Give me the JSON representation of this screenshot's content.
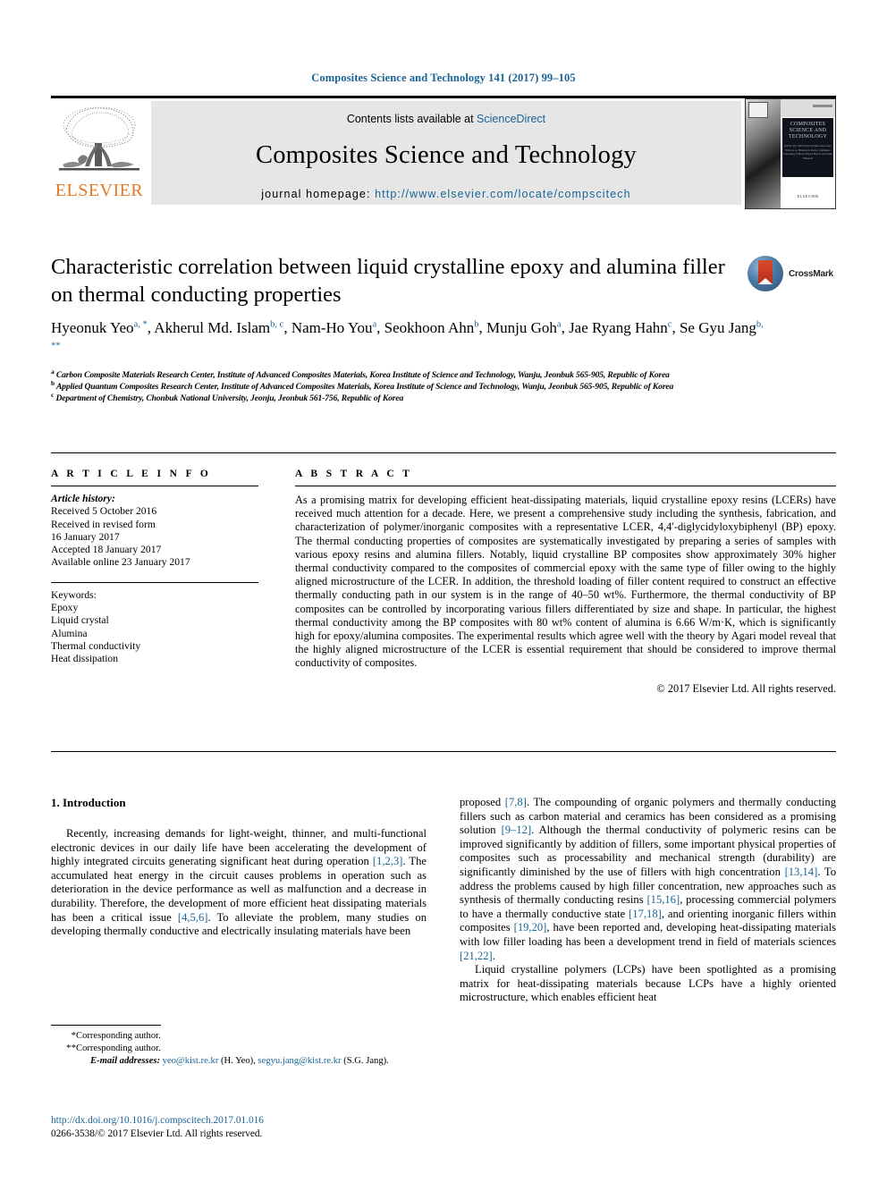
{
  "running_head": "Composites Science and Technology 141 (2017) 99–105",
  "masthead": {
    "publisher_name": "ELSEVIER",
    "contents_prefix": "Contents lists available at ",
    "contents_link": "ScienceDirect",
    "journal_title": "Composites Science and Technology",
    "homepage_label": "journal homepage: ",
    "homepage_url": "http://www.elsevier.com/locate/compscitech",
    "cover": {
      "line1": "COMPOSITES",
      "line2": "SCIENCE AND",
      "line3": "TECHNOLOGY",
      "small": "Editor-in-Chief\nKarl Schulte\n\nAssociate Editors\nA. Bismarck\nPedro Camanho\n\nFounding Editors\nBryan Harris and\nAlan Bunsell",
      "footer": "ELSEVIER"
    }
  },
  "crossmark": {
    "label": "CrossMark",
    "icon": "crossmark-icon"
  },
  "article": {
    "title": "Characteristic correlation between liquid crystalline epoxy and alumina filler on thermal conducting properties",
    "authors_line1_parts": [
      {
        "name": "Hyeonuk Yeo",
        "sup": "a, *"
      },
      {
        "name": "Akherul Md. Islam",
        "sup": "b, c"
      },
      {
        "name": "Nam-Ho You",
        "sup": "a"
      },
      {
        "name": "Seokhoon Ahn",
        "sup": "b"
      },
      {
        "name": "Munju Goh",
        "sup": "a"
      }
    ],
    "authors_line2_parts": [
      {
        "name": "Jae Ryang Hahn",
        "sup": "c"
      },
      {
        "name": "Se Gyu Jang",
        "sup": "b, **"
      }
    ],
    "affiliations": [
      {
        "marker": "a",
        "text": "Carbon Composite Materials Research Center, Institute of Advanced Composites Materials, Korea Institute of Science and Technology, Wanju, Jeonbuk 565-905, Republic of Korea"
      },
      {
        "marker": "b",
        "text": "Applied Quantum Composites Research Center, Institute of Advanced Composites Materials, Korea Institute of Science and Technology, Wanju, Jeonbuk 565-905, Republic of Korea"
      },
      {
        "marker": "c",
        "text": "Department of Chemistry, Chonbuk National University, Jeonju, Jeonbuk 561-756, Republic of Korea"
      }
    ]
  },
  "article_info": {
    "heading": "A R T I C L E   I N F O",
    "history_label": "Article history:",
    "history": [
      "Received 5 October 2016",
      "Received in revised form",
      "16 January 2017",
      "Accepted 18 January 2017",
      "Available online 23 January 2017"
    ],
    "keywords_label": "Keywords:",
    "keywords": [
      "Epoxy",
      "Liquid crystal",
      "Alumina",
      "Thermal conductivity",
      "Heat dissipation"
    ]
  },
  "abstract": {
    "heading": "A B S T R A C T",
    "text": "As a promising matrix for developing efficient heat-dissipating materials, liquid crystalline epoxy resins (LCERs) have received much attention for a decade. Here, we present a comprehensive study including the synthesis, fabrication, and characterization of polymer/inorganic composites with a representative LCER, 4,4′-diglycidyloxybiphenyl (BP) epoxy. The thermal conducting properties of composites are systematically investigated by preparing a series of samples with various epoxy resins and alumina fillers. Notably, liquid crystalline BP composites show approximately 30% higher thermal conductivity compared to the composites of commercial epoxy with the same type of filler owing to the highly aligned microstructure of the LCER. In addition, the threshold loading of filler content required to construct an effective thermally conducting path in our system is in the range of 40–50 wt%. Furthermore, the thermal conductivity of BP composites can be controlled by incorporating various fillers differentiated by size and shape. In particular, the highest thermal conductivity among the BP composites with 80 wt% content of alumina is 6.66 W/m·K, which is significantly high for epoxy/alumina composites. The experimental results which agree well with the theory by Agari model reveal that the highly aligned microstructure of the LCER is essential requirement that should be considered to improve thermal conductivity of composites.",
    "copyright": "© 2017 Elsevier Ltd. All rights reserved."
  },
  "body": {
    "section_number_title": "1. Introduction",
    "left_paragraph_1_a": "Recently, increasing demands for light-weight, thinner, and multi-functional electronic devices in our daily life have been accelerating the development of highly integrated circuits generating significant heat during operation ",
    "left_ref_1": "[1,2,3]",
    "left_paragraph_1_b": ". The accumulated heat energy in the circuit causes problems in operation such as deterioration in the device performance as well as malfunction and a decrease in durability. Therefore, the development of more efficient heat dissipating materials has been a critical issue ",
    "left_ref_2": "[4,5,6]",
    "left_paragraph_1_c": ". To alleviate the problem, many studies on developing thermally conductive and electrically insulating materials have been",
    "right_p1_a": "proposed ",
    "right_ref_1": "[7,8]",
    "right_p1_b": ". The compounding of organic polymers and thermally conducting fillers such as carbon material and ceramics has been considered as a promising solution ",
    "right_ref_2": "[9–12]",
    "right_p1_c": ". Although the thermal conductivity of polymeric resins can be improved significantly by addition of fillers, some important physical properties of composites such as processability and mechanical strength (durability) are significantly diminished by the use of fillers with high concentration ",
    "right_ref_3": "[13,14]",
    "right_p1_d": ". To address the problems caused by high filler concentration, new approaches such as synthesis of thermally conducting resins ",
    "right_ref_4": "[15,16]",
    "right_p1_e": ", processing commercial polymers to have a thermally conductive state ",
    "right_ref_5": "[17,18]",
    "right_p1_f": ", and orienting inorganic fillers within composites ",
    "right_ref_6": "[19,20]",
    "right_p1_g": ", have been reported and, developing heat-dissipating materials with low filler loading has been a development trend in field of materials sciences ",
    "right_ref_7": "[21,22]",
    "right_p1_h": ".",
    "right_p2": "Liquid crystalline polymers (LCPs) have been spotlighted as a promising matrix for heat-dissipating materials because LCPs have a highly oriented microstructure, which enables efficient heat"
  },
  "footnotes": {
    "corresponding_1_mark": "*",
    "corresponding_1": "Corresponding author.",
    "corresponding_2_mark": "**",
    "corresponding_2": "Corresponding author.",
    "email_label": "E-mail addresses:",
    "email_1": "yeo@kist.re.kr",
    "email_1_owner": " (H. Yeo), ",
    "email_2": "segyu.jang@kist.re.kr",
    "email_2_owner": " (S.G. Jang)."
  },
  "footer": {
    "doi": "http://dx.doi.org/10.1016/j.compscitech.2017.01.016",
    "issn_line": "0266-3538/© 2017 Elsevier Ltd. All rights reserved."
  },
  "colors": {
    "link": "#1a6496",
    "elsevier_orange": "#E87722",
    "band_gray": "#e6e6e6"
  }
}
